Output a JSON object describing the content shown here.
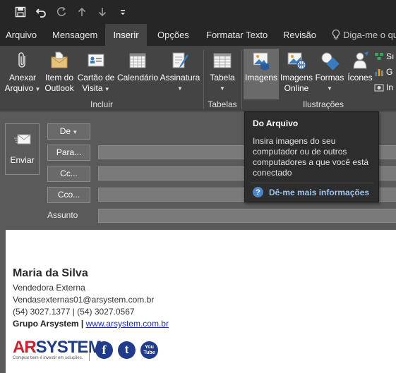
{
  "qat": {
    "icons": [
      "save-icon",
      "undo-icon",
      "redo-icon",
      "up-arrow-icon",
      "down-arrow-icon",
      "customize-icon"
    ]
  },
  "tabs": [
    {
      "label": "Arquivo"
    },
    {
      "label": "Mensagem"
    },
    {
      "label": "Inserir"
    },
    {
      "label": "Opções"
    },
    {
      "label": "Formatar Texto"
    },
    {
      "label": "Revisão"
    },
    {
      "label": "Diga-me o qu"
    }
  ],
  "ribbon": {
    "anexar_l1": "Anexar",
    "anexar_l2": "Arquivo",
    "item_l1": "Item do",
    "item_l2": "Outlook",
    "cartao_l1": "Cartão de",
    "cartao_l2": "Visita",
    "calendario": "Calendário",
    "assinatura": "Assinatura",
    "tabela": "Tabela",
    "imagens": "Imagens",
    "imagens_online_l1": "Imagens",
    "imagens_online_l2": "Online",
    "formas": "Formas",
    "icones": "Ícones",
    "small1": "Sı",
    "small2": "G",
    "small3": "In",
    "group_incluir": "Incluir",
    "group_tabelas": "Tabelas",
    "group_ilustracoes": "Ilustrações"
  },
  "header": {
    "send": "Enviar",
    "de": "De",
    "para": "Para...",
    "cc": "Cc...",
    "cco": "Cco...",
    "assunto": "Assunto"
  },
  "tooltip": {
    "title": "Do Arquivo",
    "body": "Insira imagens do seu computador ou de outros computadores a que você está conectado",
    "link": "Dê-me mais informações"
  },
  "signature": {
    "name": "Maria da Silva",
    "role": "Vendedora Externa",
    "email": "Vendasexternas01@arsystem.com.br",
    "phones": "(54) 3027.1377 | (54) 3027.0567",
    "company": "Grupo Arsystem",
    "sep": " | ",
    "website": "www.arsystem.com.br",
    "brand_ar": "AR",
    "brand_system": "SYSTEM",
    "brand_tagline": "Comprar bem é investir em soluções.",
    "social_facebook": "f",
    "social_twitter": "t",
    "social_youtube_l1": "You",
    "social_youtube_l2": "Tube"
  },
  "colors": {
    "accent_link": "#9fc4ee",
    "brand_red": "#d01f2a",
    "brand_blue": "#1f3c8c"
  }
}
